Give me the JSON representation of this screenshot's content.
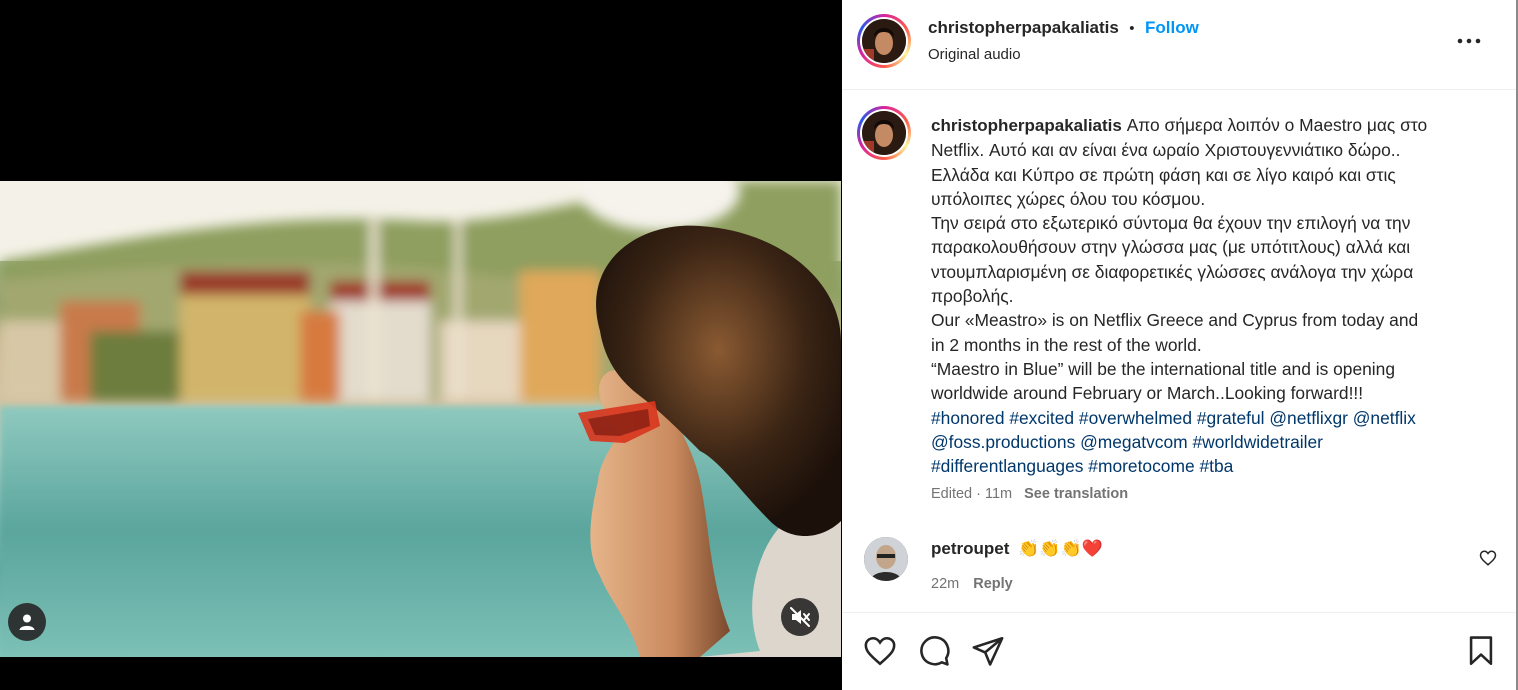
{
  "post": {
    "author": "christopherpapakaliatis",
    "separator": "•",
    "follow_label": "Follow",
    "audio": "Original audio",
    "caption_lines": [
      "Απο σήμερα λοιπόν ο Maestro μας στο",
      "Netflix. Αυτό και αν είναι ένα ωραίο Χριστουγεννιάτικο δώρο..",
      "Ελλάδα και Κύπρο σε πρώτη φάση και σε λίγο καιρό και στις",
      "υπόλοιπες χώρες όλου του κόσμου.",
      "Την σειρά στο εξωτερικό σύντομα θα έχουν την επιλογή να την",
      "παρακολουθήσουν στην γλώσσα μας (με υπότιτλους) αλλά και",
      "ντουμπλαρισμένη σε διαφορετικές γλώσσες ανάλογα την χώρα",
      "προβολής.",
      "Our «Meastro» is on Netflix Greece and Cyprus from today and",
      "in 2 months in the rest of the world.",
      "“Maestro in Blue” will be the international title and is opening",
      "worldwide around February or March..Looking forward!!!"
    ],
    "hashtag_lines": [
      "#honored #excited #overwhelmed #grateful @netflixgr @netflix",
      "@foss.productions @megatvcom #worldwidetrailer",
      "#differentlanguages #moretocome #tba"
    ],
    "edited": "Edited · 11m",
    "see_translation": "See translation"
  },
  "comment": {
    "user": "petroupet",
    "text": "👏👏👏❤️",
    "time": "22m",
    "reply_label": "Reply"
  },
  "icons": {
    "more": "more-options-icon",
    "user": "user-tag-icon",
    "mute": "audio-muted-icon",
    "like": "heart-icon",
    "comment": "comment-icon",
    "share": "share-icon",
    "save": "bookmark-icon"
  },
  "colors": {
    "follow": "#0095f6",
    "hashtag": "#00376b",
    "muted_text": "#737373"
  }
}
